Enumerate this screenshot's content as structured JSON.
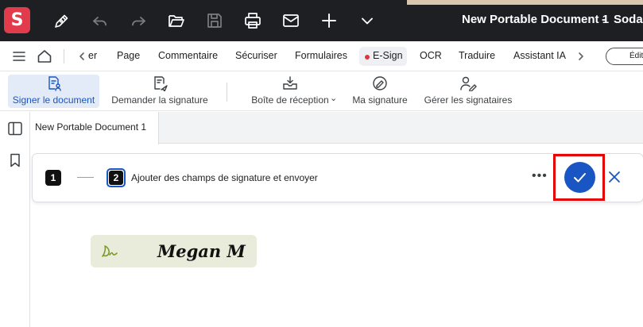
{
  "app": {
    "logo_letter": "S",
    "title": "New Portable Document 1",
    "separator": "-",
    "app_name": "Soda P",
    "brand_color": "#e23b4b",
    "accent_color": "#1a55c4"
  },
  "titlebar": {
    "icons": [
      "pen-icon",
      "undo-icon",
      "redo-icon",
      "folder-open-icon",
      "save-icon",
      "print-icon",
      "mail-icon",
      "plus-icon",
      "chevron-down-icon"
    ]
  },
  "menubar": {
    "items": [
      {
        "label": "er"
      },
      {
        "label": "Page"
      },
      {
        "label": "Commentaire"
      },
      {
        "label": "Sécuriser"
      },
      {
        "label": "Formulaires"
      },
      {
        "label": "E-Sign",
        "active": true
      },
      {
        "label": "OCR"
      },
      {
        "label": "Traduire"
      },
      {
        "label": "Assistant IA"
      }
    ],
    "edit_button": "Édition"
  },
  "ribbon": {
    "buttons": [
      {
        "label": "Signer le document",
        "selected": true
      },
      {
        "label": "Demander la signature"
      },
      {
        "label": "Boîte de réception"
      },
      {
        "label": "Ma signature"
      },
      {
        "label": "Gérer les signataires"
      }
    ]
  },
  "tabs": [
    {
      "label": "New Portable Document 1"
    }
  ],
  "steps": {
    "step1_number": "1",
    "step2_number": "2",
    "step2_label": "Ajouter des champs de signature et envoyer",
    "more_label": "•••"
  },
  "signature": {
    "mark": "Ds",
    "name": "Megan M"
  }
}
